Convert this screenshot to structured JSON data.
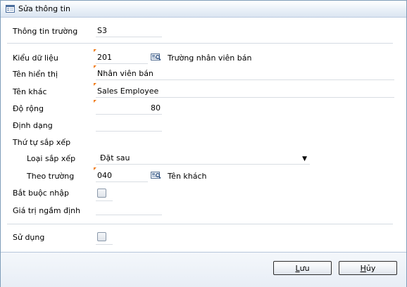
{
  "title": "Sửa thông tin",
  "fields": {
    "field_info": {
      "label": "Thông tin trường",
      "value": "S3"
    },
    "data_type": {
      "label": "Kiểu dữ liệu",
      "value": "201",
      "lookup_text": "Trường nhân viên bán"
    },
    "display_name": {
      "label": "Tên hiển thị",
      "value": "Nhân viên bán"
    },
    "other_name": {
      "label": "Tên khác",
      "value": "Sales Employee"
    },
    "width": {
      "label": "Độ rộng",
      "value": "80"
    },
    "format": {
      "label": "Định dạng",
      "value": ""
    },
    "sort_order": {
      "label": "Thứ tự sắp xếp"
    },
    "sort_type": {
      "label": "Loại sắp xếp",
      "value": "Đặt sau"
    },
    "sort_field": {
      "label": "Theo trường",
      "value": "040",
      "lookup_text": "Tên khách"
    },
    "required": {
      "label": "Bắt buộc nhập",
      "checked": false
    },
    "default_value": {
      "label": "Giá trị ngầm định",
      "value": ""
    },
    "in_use": {
      "label": "Sử dụng",
      "checked": false
    }
  },
  "buttons": {
    "save": {
      "label_ul": "L",
      "label_rest": "ưu"
    },
    "cancel": {
      "label_ul": "H",
      "label_rest": "ủy"
    }
  },
  "icons": {
    "title": "form-edit-icon",
    "lookup": "lookup-icon",
    "dropdown": "chevron-down-icon"
  },
  "colors": {
    "required_marker": "#f07c1a",
    "title_gradient_end": "#dbe5f1",
    "footer_background": "#e8eef6"
  }
}
